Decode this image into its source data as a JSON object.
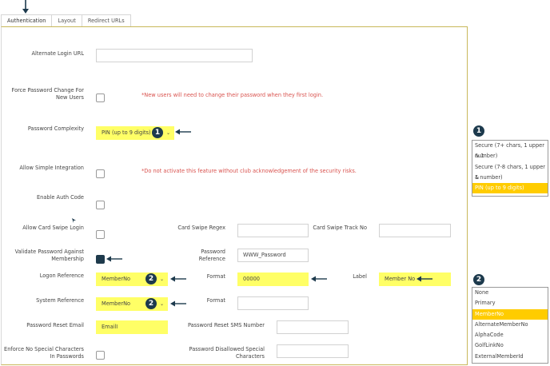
{
  "tabs": [
    "Authentication",
    "Layout",
    "Redirect URLs"
  ],
  "fields": {
    "alternate_login_url": "Alternate Login URL",
    "force_pw_change": "Force Password Change For New Users",
    "force_pw_note": "*New users will need to change their password when they first login.",
    "password_complexity": "Password Complexity",
    "password_complexity_value": "PIN (up to 9 digits)",
    "allow_simple_integration": "Allow Simple Integration",
    "simple_integration_note": "*Do not activate this feature without club acknowledgement of the security risks.",
    "enable_auth_code": "Enable Auth Code",
    "allow_card_swipe_login": "Allow Card Swipe Login",
    "card_swipe_regex": "Card Swipe Regex",
    "card_swipe_track_no": "Card Swipe Track No",
    "validate_password": "Validate Password Against Membership",
    "password_reference": "Password Reference",
    "password_reference_value": "WWW_Password",
    "logon_reference": "Logon Reference",
    "logon_reference_value": "MemberNo",
    "format": "Format",
    "logon_format_value": "00000",
    "label": "Label",
    "label_value": "Member No",
    "system_reference": "System Reference",
    "system_reference_value": "MemberNo",
    "password_reset_email": "Password Reset Email",
    "password_reset_email_value": "EmailI",
    "password_reset_sms": "Password Reset SMS Number",
    "enforce_no_special": "Enforce No Special Characters In Passwords",
    "password_disallowed_special": "Password Disallowed Special Characters"
  },
  "badges": [
    "1",
    "2",
    "2"
  ],
  "complexity_options": {
    "badge": "1",
    "items": [
      "Secure (7+ chars, 1 upper & 1",
      "number)",
      "Secure (7-8 chars, 1 upper &",
      "1 number)",
      "PIN (up to 9 digits)"
    ]
  },
  "reference_options": {
    "badge": "2",
    "items": [
      "None",
      "Primary",
      "MemberNo",
      "AlternateMemberNo",
      "AlphaCode",
      "GolfLinkNo",
      "ExternalMemberId"
    ]
  },
  "colors": {
    "highlight": "#ffff66",
    "badge": "#1d3a4d",
    "selected_option": "#ffcc00",
    "note": "#d9534f"
  }
}
